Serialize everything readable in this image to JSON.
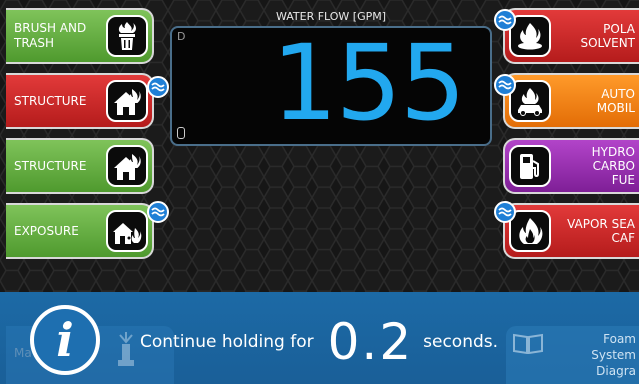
{
  "header": {
    "flow_title": "WATER FLOW [GPM]",
    "flow_value": "155",
    "display_mark": "D"
  },
  "left_cards": [
    {
      "label": "BRUSH AND\nTRASH",
      "icon": "trash-fire-icon",
      "color": "#5da83a",
      "foam": false
    },
    {
      "label": "STRUCTURE",
      "icon": "house-fire-icon",
      "color": "#c42424",
      "foam": true
    },
    {
      "label": "STRUCTURE",
      "icon": "house-fire-icon",
      "color": "#5da83a",
      "foam": false
    },
    {
      "label": "EXPOSURE",
      "icon": "house-exposure-icon",
      "color": "#5da83a",
      "foam": true
    }
  ],
  "right_cards": [
    {
      "label": "POLA\nSOLVENT",
      "icon": "polar-solvent-fire-icon",
      "color": "#c42424",
      "foam": true
    },
    {
      "label": "AUTO\nMOBIL",
      "icon": "car-fire-icon",
      "color": "#f07d10",
      "foam": true
    },
    {
      "label": "HYDRO\nCARBO\nFUE",
      "icon": "fuel-pump-icon",
      "color": "#9b2fb3",
      "foam": false
    },
    {
      "label": "VAPOR SEA\nCAF",
      "icon": "vapor-seal-fire-icon",
      "color": "#c42424",
      "foam": true
    }
  ],
  "bottom": {
    "message_pre": "Continue holding for",
    "message_value": "0.2",
    "message_post": "seconds.",
    "left_faint_label": "Ma",
    "foam_diagram_label": "Foam System\nDiagra"
  },
  "colors": {
    "accent_blue": "#22a8ef",
    "bar_blue": "#1c6aa6"
  }
}
